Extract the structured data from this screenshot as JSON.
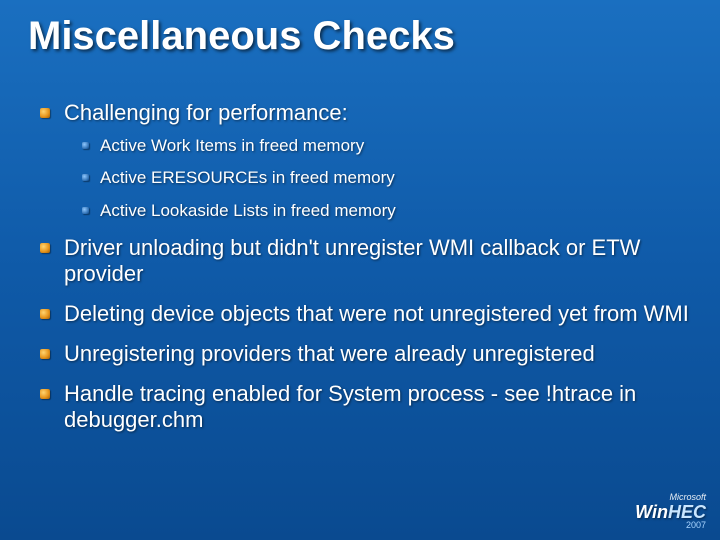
{
  "title": "Miscellaneous Checks",
  "bullets": {
    "b0": {
      "text": "Challenging for performance:",
      "sub": {
        "s0": "Active Work Items in freed memory",
        "s1": "Active ERESOURCEs in freed memory",
        "s2": "Active Lookaside Lists in freed memory"
      }
    },
    "b1": {
      "text": "Driver unloading but didn't unregister WMI callback or ETW provider"
    },
    "b2": {
      "text": "Deleting device objects that were not unregistered yet from WMI"
    },
    "b3": {
      "text": "Unregistering providers that were already unregistered"
    },
    "b4": {
      "text": "Handle tracing enabled for System process - see !htrace in debugger.chm"
    }
  },
  "footer": {
    "ms": "Microsoft",
    "brand_a": "Win",
    "brand_b": "HEC",
    "year": "2007"
  }
}
